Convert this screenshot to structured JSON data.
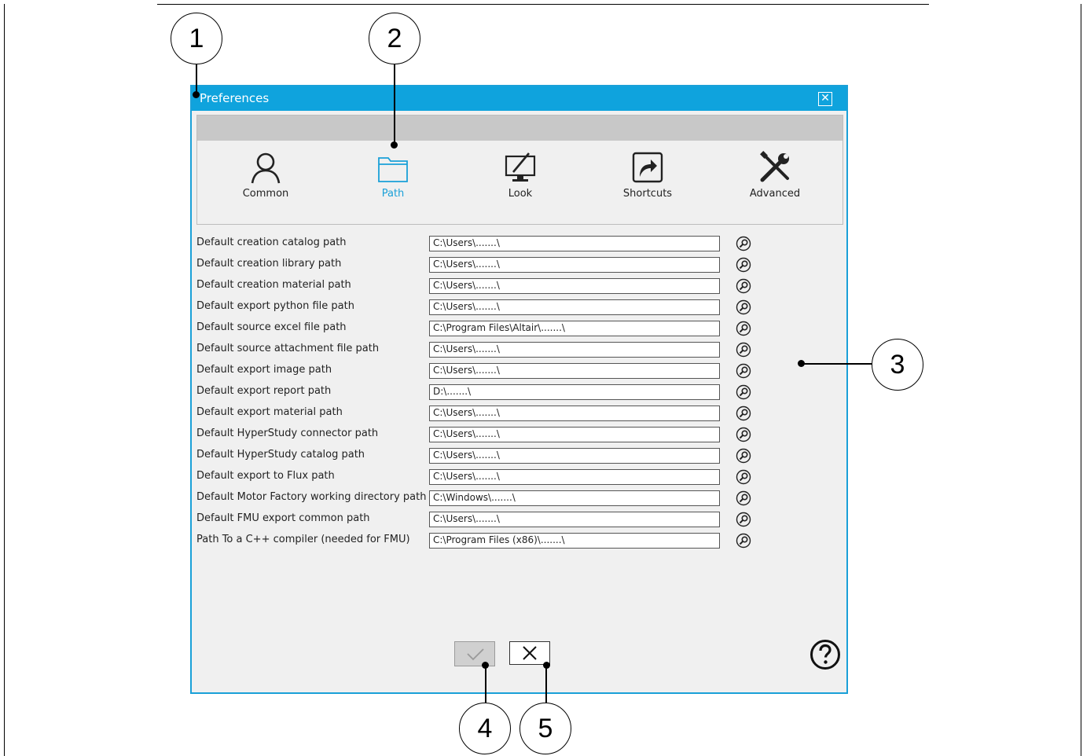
{
  "window": {
    "title": "Preferences",
    "close_icon": "close-icon"
  },
  "tabs": [
    {
      "label": "Common",
      "icon": "user-icon"
    },
    {
      "label": "Path",
      "icon": "folder-icon",
      "active": true
    },
    {
      "label": "Look",
      "icon": "display-icon"
    },
    {
      "label": "Shortcuts",
      "icon": "shortcut-icon"
    },
    {
      "label": "Advanced",
      "icon": "tools-icon"
    }
  ],
  "paths": [
    {
      "label": "Default creation catalog path",
      "value": "C:\\Users\\.......\\"
    },
    {
      "label": "Default creation library path",
      "value": "C:\\Users\\.......\\"
    },
    {
      "label": "Default creation material path",
      "value": "C:\\Users\\.......\\"
    },
    {
      "label": "Default export python file path",
      "value": "C:\\Users\\.......\\"
    },
    {
      "label": "Default source excel file path",
      "value": "C:\\Program Files\\Altair\\.......\\"
    },
    {
      "label": "Default source attachment file path",
      "value": "C:\\Users\\.......\\"
    },
    {
      "label": "Default export image path",
      "value": "C:\\Users\\.......\\"
    },
    {
      "label": "Default export report path",
      "value": "D:\\.......\\"
    },
    {
      "label": "Default export material path",
      "value": "C:\\Users\\.......\\"
    },
    {
      "label": "Default HyperStudy connector path",
      "value": "C:\\Users\\.......\\"
    },
    {
      "label": "Default HyperStudy catalog path",
      "value": "C:\\Users\\.......\\"
    },
    {
      "label": "Default export to Flux path",
      "value": "C:\\Users\\.......\\"
    },
    {
      "label": "Default Motor Factory working directory path",
      "value": "C:\\Windows\\.......\\"
    },
    {
      "label": "Default FMU export common path",
      "value": "C:\\Users\\.......\\"
    },
    {
      "label": "Path To a C++ compiler (needed for FMU)",
      "value": "C:\\Program Files (x86)\\.......\\"
    }
  ],
  "browse_icon": "browse-search-icon",
  "footer": {
    "ok_icon": "checkmark-icon",
    "cancel_icon": "x-icon",
    "help_icon": "help-icon"
  },
  "callouts": [
    "1",
    "2",
    "3",
    "4",
    "5"
  ],
  "colors": {
    "accent": "#0fa3dd",
    "dialog_bg": "#f0f0f0",
    "header_gray": "#c8c8c8"
  }
}
